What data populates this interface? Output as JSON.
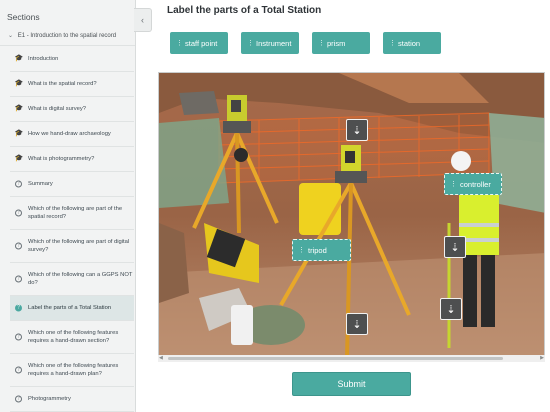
{
  "sidebar": {
    "header": "Sections",
    "collapse_icon": "chevron-left-icon",
    "section_title": "E1 - Introduction to the spatial record",
    "items": [
      {
        "label": "Introduction",
        "icon": "graduation-cap-icon",
        "active": false
      },
      {
        "label": "What is the spatial record?",
        "icon": "graduation-cap-icon",
        "active": false
      },
      {
        "label": "What is digital survey?",
        "icon": "graduation-cap-icon",
        "active": false
      },
      {
        "label": "How we hand-draw archaeology",
        "icon": "graduation-cap-icon",
        "active": false
      },
      {
        "label": "What is photogrammetry?",
        "icon": "graduation-cap-icon",
        "active": false
      },
      {
        "label": "Summary",
        "icon": "question-circle-icon",
        "active": false
      },
      {
        "label": "Which of the following are part of the spatial record?",
        "icon": "question-circle-icon",
        "active": false
      },
      {
        "label": "Which of the following are part of digital survey?",
        "icon": "question-circle-icon",
        "active": false
      },
      {
        "label": "Which of the following can a GGPS NOT do?",
        "icon": "question-circle-icon",
        "active": false
      },
      {
        "label": "Label the parts of a Total Station",
        "icon": "question-circle-icon",
        "active": true
      },
      {
        "label": "Which one of the following features requires a hand-drawn section?",
        "icon": "question-circle-icon",
        "active": false
      },
      {
        "label": "Which one of the following features requires a hand-drawn plan?",
        "icon": "question-circle-icon",
        "active": false
      },
      {
        "label": "Photogrammetry",
        "icon": "question-circle-icon",
        "active": false
      }
    ]
  },
  "main": {
    "title": "Label the parts of a Total Station",
    "labels": [
      "staff point",
      "Instrument",
      "prism",
      "station"
    ],
    "placed_labels": {
      "controller": "controller",
      "tripod": "tripod"
    },
    "dropzone_icon": "arrow-down-icon",
    "submit_label": "Submit"
  },
  "colors": {
    "accent": "#4aaaa0",
    "dropzone": "#4e4f50"
  }
}
